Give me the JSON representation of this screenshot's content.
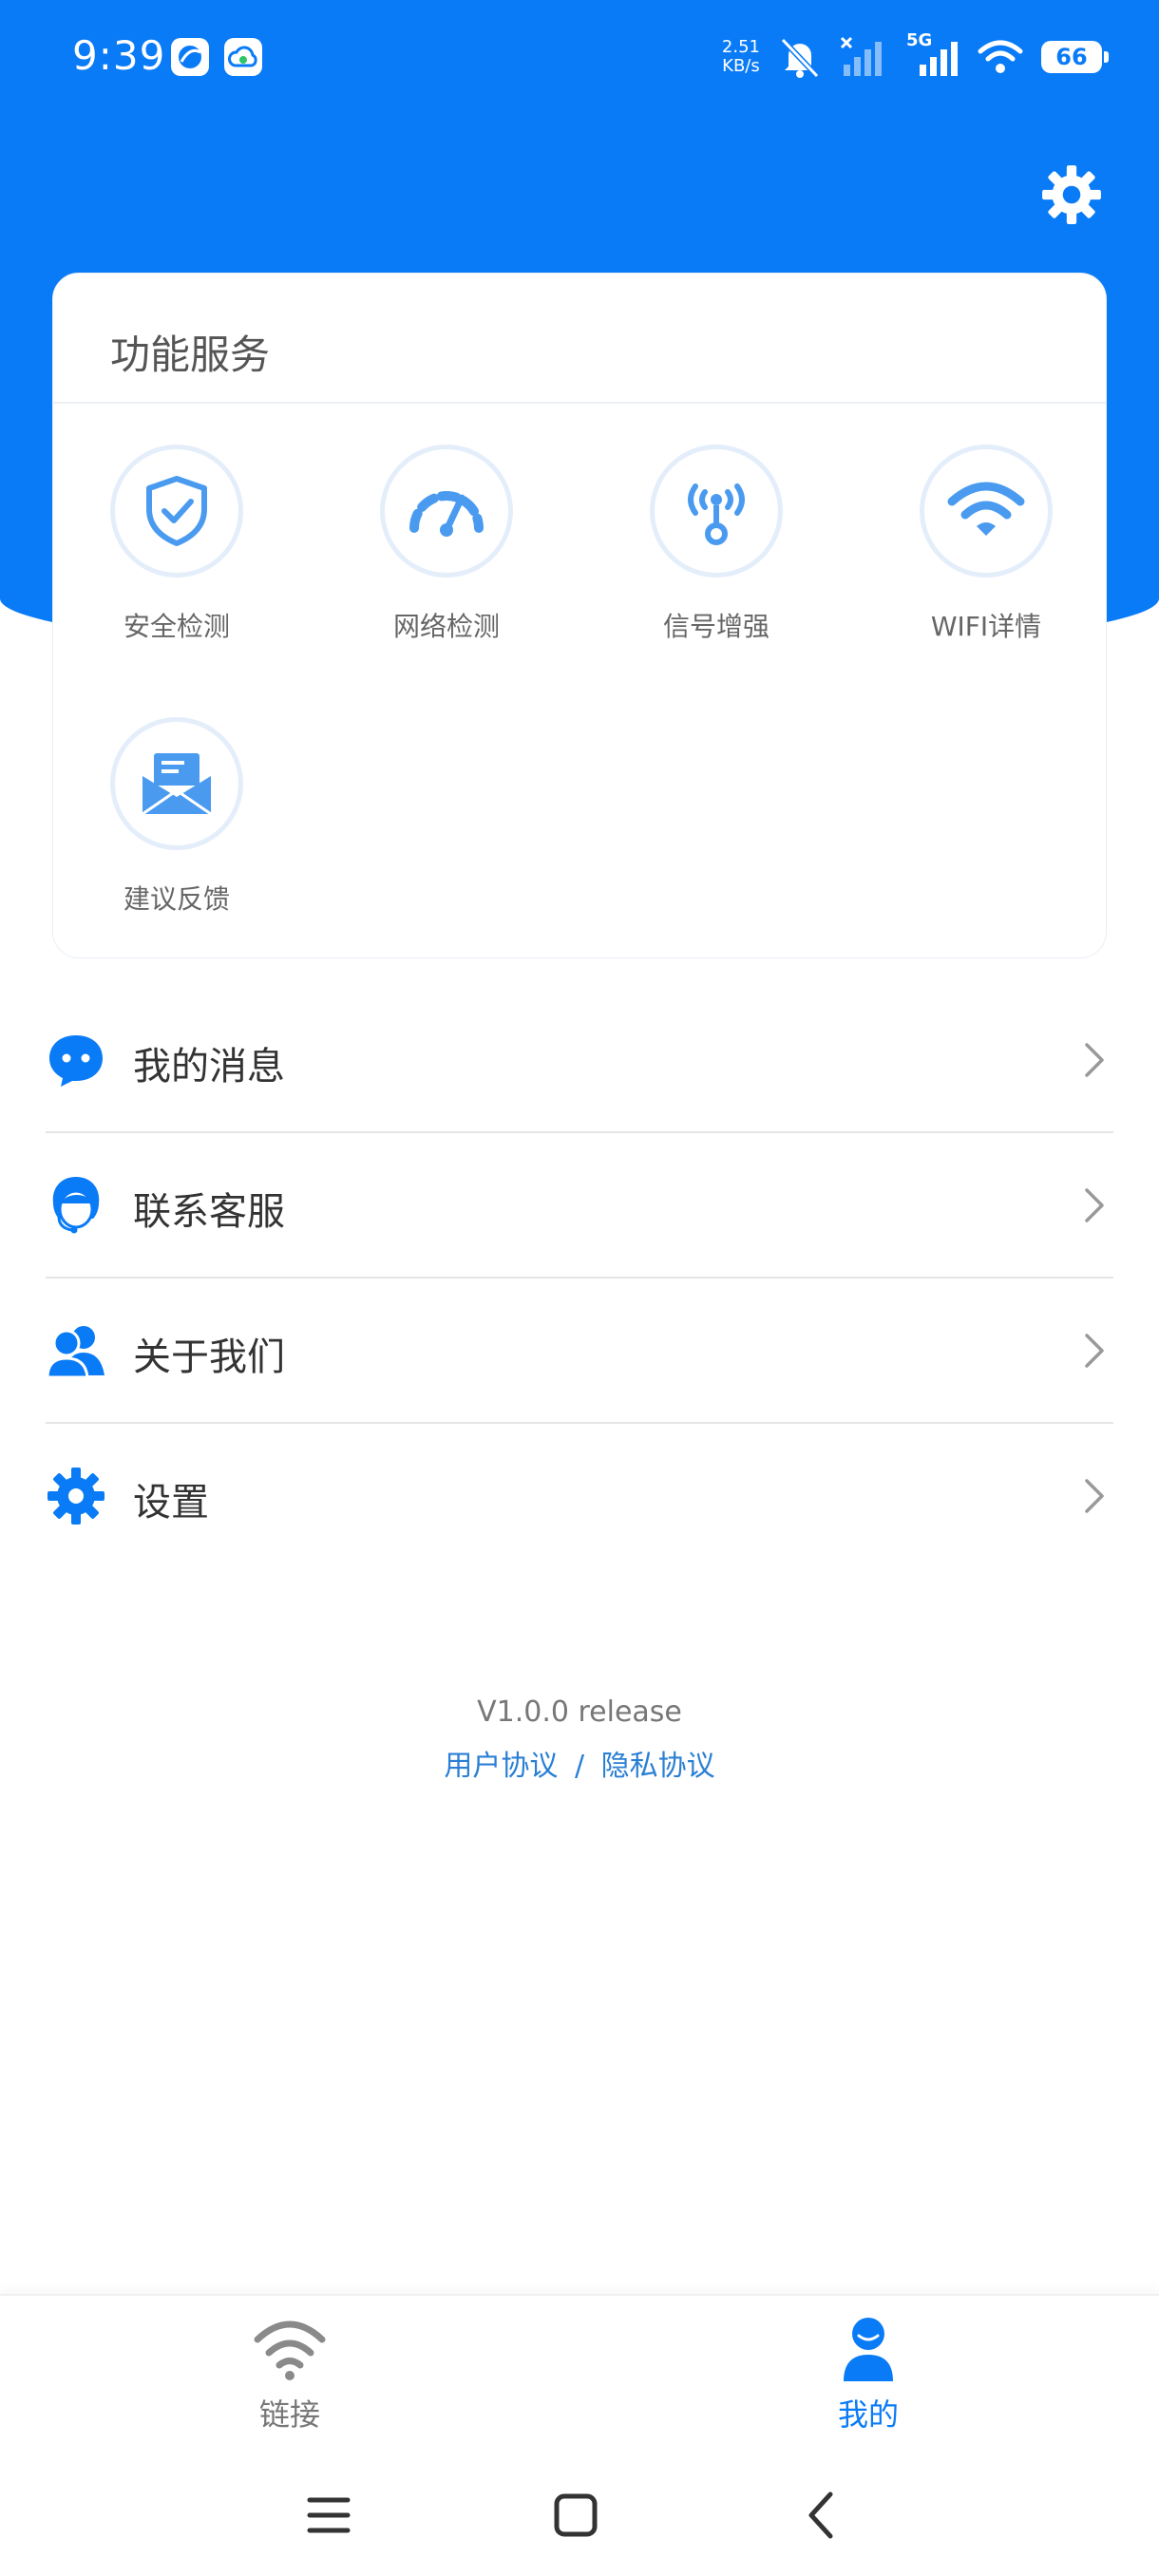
{
  "status_bar": {
    "time": "9:39",
    "net_speed_value": "2.51",
    "net_speed_unit": "KB/s",
    "network_type": "5G",
    "battery_level": "66"
  },
  "services": {
    "title": "功能服务",
    "items": [
      {
        "label": "安全检测",
        "icon": "shield-check-icon"
      },
      {
        "label": "网络检测",
        "icon": "speedometer-icon"
      },
      {
        "label": "信号增强",
        "icon": "antenna-icon"
      },
      {
        "label": "WIFI详情",
        "icon": "wifi-icon"
      },
      {
        "label": "建议反馈",
        "icon": "envelope-icon"
      }
    ]
  },
  "menu": [
    {
      "label": "我的消息",
      "icon": "chat-bubble-icon"
    },
    {
      "label": "联系客服",
      "icon": "customer-service-icon"
    },
    {
      "label": "关于我们",
      "icon": "users-icon"
    },
    {
      "label": "设置",
      "icon": "gear-icon"
    }
  ],
  "footer": {
    "version": "V1.0.0 release",
    "user_agreement": "用户协议",
    "separator": "/",
    "privacy_policy": "隐私协议"
  },
  "tabbar": {
    "tabs": [
      {
        "label": "链接",
        "icon": "wifi-icon",
        "active": false
      },
      {
        "label": "我的",
        "icon": "user-icon",
        "active": true
      }
    ]
  },
  "colors": {
    "primary": "#0A7BF6",
    "icon_light": "#4A9BF0",
    "tab_inactive": "#777777",
    "link": "#2A7FD4"
  }
}
